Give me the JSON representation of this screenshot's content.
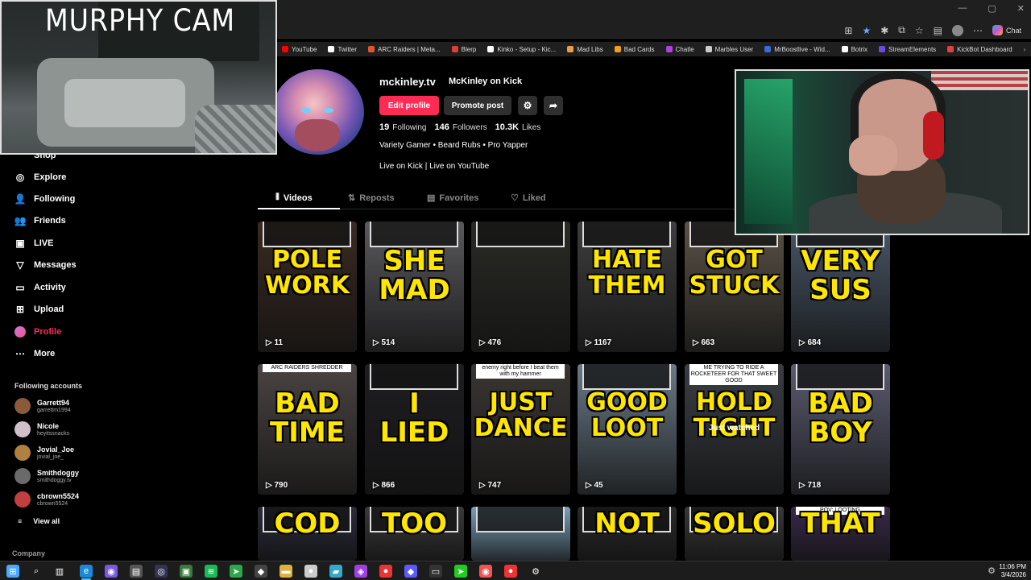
{
  "overlay": {
    "cam_title": "MURPHY CAM"
  },
  "bookmarks": [
    {
      "label": "YouTube",
      "color": "#ff0000"
    },
    {
      "label": "Twitter",
      "color": "#ffffff"
    },
    {
      "label": "ARC Raiders | Meta...",
      "color": "#e0552e"
    },
    {
      "label": "Blerp",
      "color": "#e43a3a"
    },
    {
      "label": "Kinko - Setup - Kic...",
      "color": "#ffffff"
    },
    {
      "label": "Mad Libs",
      "color": "#e8a040"
    },
    {
      "label": "Bad Cards",
      "color": "#f0a020"
    },
    {
      "label": "Chatle",
      "color": "#b040e0"
    },
    {
      "label": "Marbles User",
      "color": "#cccccc"
    },
    {
      "label": "MrBoostlive - Wid...",
      "color": "#3a6ad8"
    },
    {
      "label": "Botrix",
      "color": "#ffffff"
    },
    {
      "label": "StreamElements",
      "color": "#6a4ae0"
    },
    {
      "label": "KickBot Dashboard",
      "color": "#e04040"
    }
  ],
  "browser": {
    "chat_label": "Chat"
  },
  "sidebar": {
    "shop_label": "Shop",
    "items": [
      {
        "label": "Explore",
        "icon": "compass-icon",
        "glyph": "◎"
      },
      {
        "label": "Following",
        "icon": "following-icon",
        "glyph": "👤"
      },
      {
        "label": "Friends",
        "icon": "friends-icon",
        "glyph": "👥"
      },
      {
        "label": "LIVE",
        "icon": "live-icon",
        "glyph": "▣"
      },
      {
        "label": "Messages",
        "icon": "messages-icon",
        "glyph": "▽"
      },
      {
        "label": "Activity",
        "icon": "activity-icon",
        "glyph": "▭"
      },
      {
        "label": "Upload",
        "icon": "upload-icon",
        "glyph": "⊞"
      },
      {
        "label": "Profile",
        "icon": "profile-icon",
        "glyph": ""
      },
      {
        "label": "More",
        "icon": "more-icon",
        "glyph": "⋯"
      }
    ],
    "following_title": "Following accounts",
    "accounts": [
      {
        "name": "Garrett94",
        "handle": "garrettm1994",
        "color": "#8a5a3a"
      },
      {
        "name": "Nicole",
        "handle": "heyitssnacks",
        "color": "#d0c0c8"
      },
      {
        "name": "Jovial_Joe",
        "handle": "jovial_joe_",
        "color": "#b08040"
      },
      {
        "name": "Smithdoggy",
        "handle": "smithdoggy.tv",
        "color": "#6a6a6a"
      },
      {
        "name": "cbrown5524",
        "handle": "cbrown5524",
        "color": "#c04040"
      }
    ],
    "view_all": "View all",
    "company": "Company"
  },
  "profile": {
    "handle": "mckinley.tv",
    "display_name": "McKinley on Kick",
    "edit_label": "Edit profile",
    "promote_label": "Promote post",
    "following_count": "19",
    "following_label": "Following",
    "followers_count": "146",
    "followers_label": "Followers",
    "likes_count": "10.3K",
    "likes_label": "Likes",
    "bio_line1": "Variety Gamer • Beard Rubs • Pro Yapper",
    "bio_line2": "Live on Kick | Live on YouTube"
  },
  "tabs": [
    {
      "label": "Videos",
      "glyph": "⦀"
    },
    {
      "label": "Reposts",
      "glyph": "⇅"
    },
    {
      "label": "Favorites",
      "glyph": "▤"
    },
    {
      "label": "Liked",
      "glyph": "♡"
    }
  ],
  "videos": [
    {
      "caption": "POLE WORK",
      "views": "11",
      "bg": "#3a2a22"
    },
    {
      "caption": "SHE MAD",
      "views": "514",
      "bg": "#5a5a5e"
    },
    {
      "caption": "",
      "views": "476",
      "bg": "#2a2a26"
    },
    {
      "caption": "HATE THEM",
      "views": "1167",
      "bg": "#3e3e3e"
    },
    {
      "caption": "GOT STUCK",
      "views": "663",
      "bg": "#5a5248"
    },
    {
      "caption": "VERY SUS",
      "views": "684",
      "bg": "#4a5868"
    },
    {
      "caption": "BAD TIME",
      "views": "790",
      "bg": "#4a4442",
      "sub": "ARC RAIDERS SHREDDER"
    },
    {
      "caption": "I LIED",
      "views": "866",
      "bg": "#1e1e22"
    },
    {
      "caption": "JUST DANCE",
      "views": "747",
      "bg": "#3a3632",
      "sub": "enemy right before I beat them with my hammer"
    },
    {
      "caption": "GOOD LOOT",
      "views": "45",
      "bg": "#6a7a88"
    },
    {
      "caption": "HOLD TIGHT",
      "views": "",
      "bg": "#3a3e44",
      "sub": "ME TRYING TO RIDE A ROCKETEER FOR THAT SWEET GOOD",
      "overlay": "Just watched"
    },
    {
      "caption": "BAD BOY",
      "views": "718",
      "bg": "#5a5c70"
    },
    {
      "caption": "COD",
      "views": "",
      "bg": "#2a2c3a"
    },
    {
      "caption": "TOO",
      "views": "",
      "bg": "#3a3a3a"
    },
    {
      "caption": "",
      "views": "",
      "bg": "#7aa0b8"
    },
    {
      "caption": "NOT",
      "views": "",
      "bg": "#2a2a2a"
    },
    {
      "caption": "SOLO",
      "views": "",
      "bg": "#3a3838"
    },
    {
      "caption": "THAT",
      "views": "",
      "bg": "#3a2a4a",
      "sub": "POV: LOOTING"
    }
  ],
  "clock": {
    "time": "11:06 PM",
    "date": "3/4/2026"
  }
}
